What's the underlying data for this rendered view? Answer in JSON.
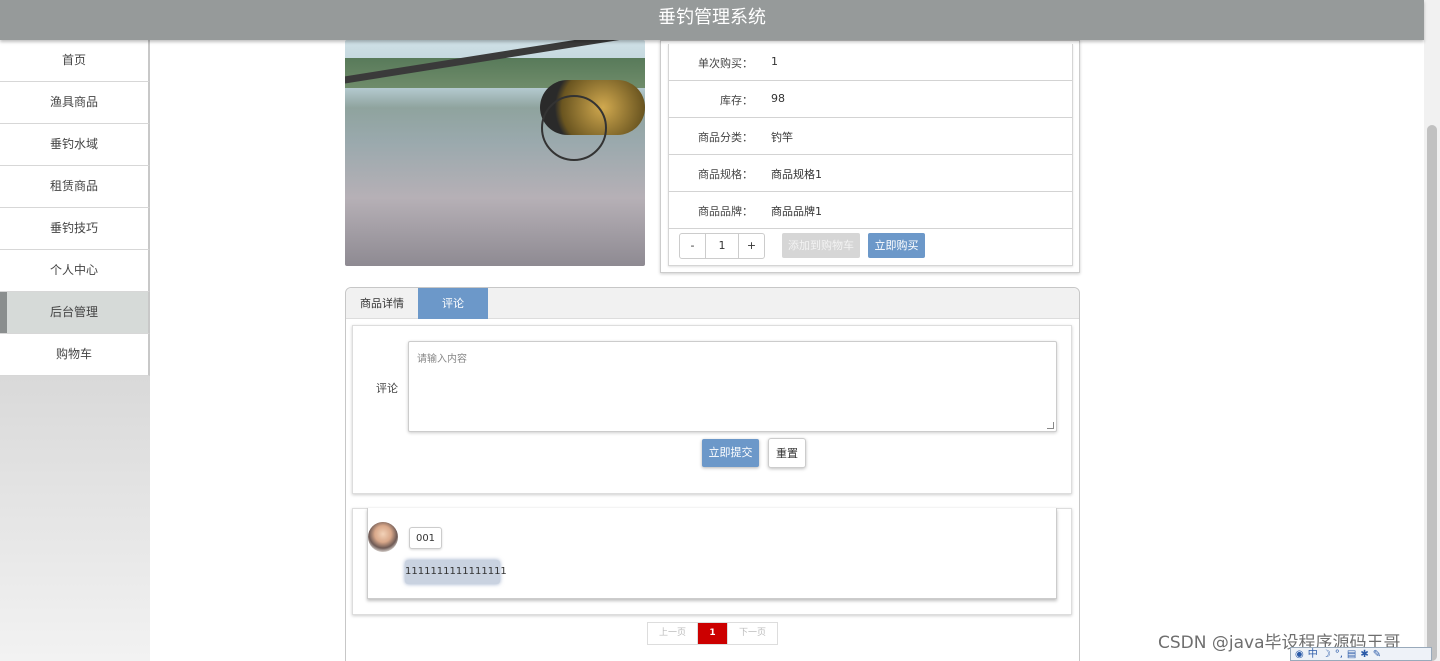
{
  "header": {
    "title": "垂钓管理系统"
  },
  "sidebar": {
    "items": [
      {
        "label": "首页"
      },
      {
        "label": "渔具商品"
      },
      {
        "label": "垂钓水域"
      },
      {
        "label": "租赁商品"
      },
      {
        "label": "垂钓技巧"
      },
      {
        "label": "个人中心"
      },
      {
        "label": "后台管理",
        "active": true
      },
      {
        "label": "购物车"
      }
    ]
  },
  "product": {
    "rows": [
      {
        "label": "单次购买：",
        "value": "1"
      },
      {
        "label": "库存：",
        "value": "98"
      },
      {
        "label": "商品分类：",
        "value": "钓竿"
      },
      {
        "label": "商品规格：",
        "value": "商品规格1"
      },
      {
        "label": "商品品牌：",
        "value": "商品品牌1"
      }
    ],
    "quantity": {
      "minus": "-",
      "value": "1",
      "plus": "+"
    },
    "add_to_cart_label": "添加到购物车",
    "buy_now_label": "立即购买"
  },
  "tabs": [
    {
      "label": "商品详情"
    },
    {
      "label": "评论",
      "active": true
    }
  ],
  "comment_form": {
    "label": "评论",
    "placeholder": "请输入内容",
    "submit_label": "立即提交",
    "reset_label": "重置"
  },
  "comments": [
    {
      "username": "001",
      "content": "1111111111111111"
    }
  ],
  "pagination": {
    "prev_label": "上一页",
    "current": "1",
    "next_label": "下一页"
  },
  "watermark": "CSDN @java毕设程序源码王哥",
  "ime": {
    "mode": "中"
  },
  "colors": {
    "header_bg": "#969a9a",
    "accent": "#6c98c9",
    "page_active": "#cc0000"
  }
}
